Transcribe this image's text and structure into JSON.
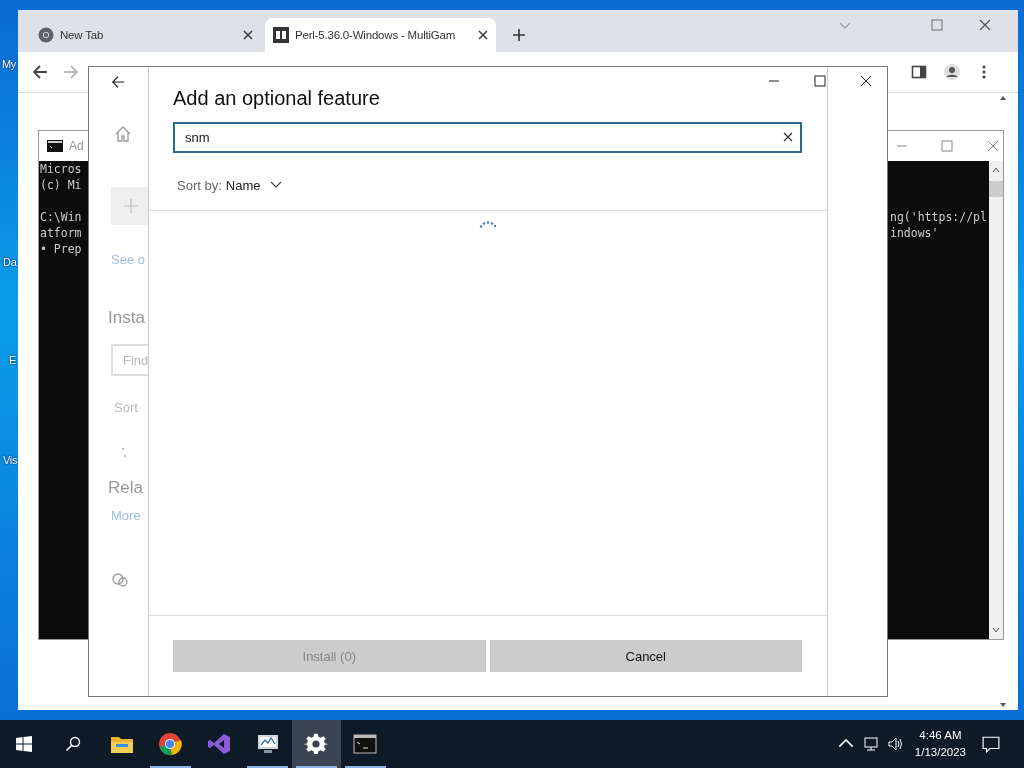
{
  "desktop_icons": [
    {
      "label": "My"
    },
    {
      "label": "Da"
    },
    {
      "label": "E"
    },
    {
      "label": "Vis"
    }
  ],
  "browser": {
    "tabs": [
      {
        "title": "New Tab",
        "kind": "chrome",
        "selected": false
      },
      {
        "title": "Perl-5.36.0-Windows - MultiGam",
        "kind": "site",
        "selected": true
      }
    ]
  },
  "console": {
    "title": "Ad",
    "lines": [
      {
        "left": "Micros"
      },
      {
        "left": "(c) Mi"
      },
      {
        "left": "C:\\Win",
        "right": "ng('https://pl",
        "gap_before": true
      },
      {
        "left": "atform",
        "right": "indows'"
      },
      {
        "left": "• Prep"
      }
    ]
  },
  "settings": {
    "see_link": "See o",
    "installed_heading": "Insta",
    "find_placeholder": "Find",
    "sort_label": "Sort",
    "related_heading": "Rela",
    "more_link": "More"
  },
  "dialog": {
    "title": "Add an optional feature",
    "search": {
      "value": "snm"
    },
    "sort_label": "Sort by:",
    "sort_value": "Name",
    "loading": true,
    "buttons": [
      {
        "label": "Install (0)",
        "disabled": true
      },
      {
        "label": "Cancel",
        "disabled": false
      }
    ]
  },
  "taskbar": {
    "apps": [
      {
        "kind": "explorer",
        "running": false,
        "selected": false
      },
      {
        "kind": "chrome",
        "running": true,
        "selected": false
      },
      {
        "kind": "studio",
        "running": false,
        "selected": false
      },
      {
        "kind": "monitor",
        "running": true,
        "selected": false
      },
      {
        "kind": "settings",
        "running": true,
        "selected": true
      },
      {
        "kind": "console",
        "running": true,
        "selected": false
      }
    ],
    "time": "4:46 AM",
    "date": "1/13/2023"
  }
}
